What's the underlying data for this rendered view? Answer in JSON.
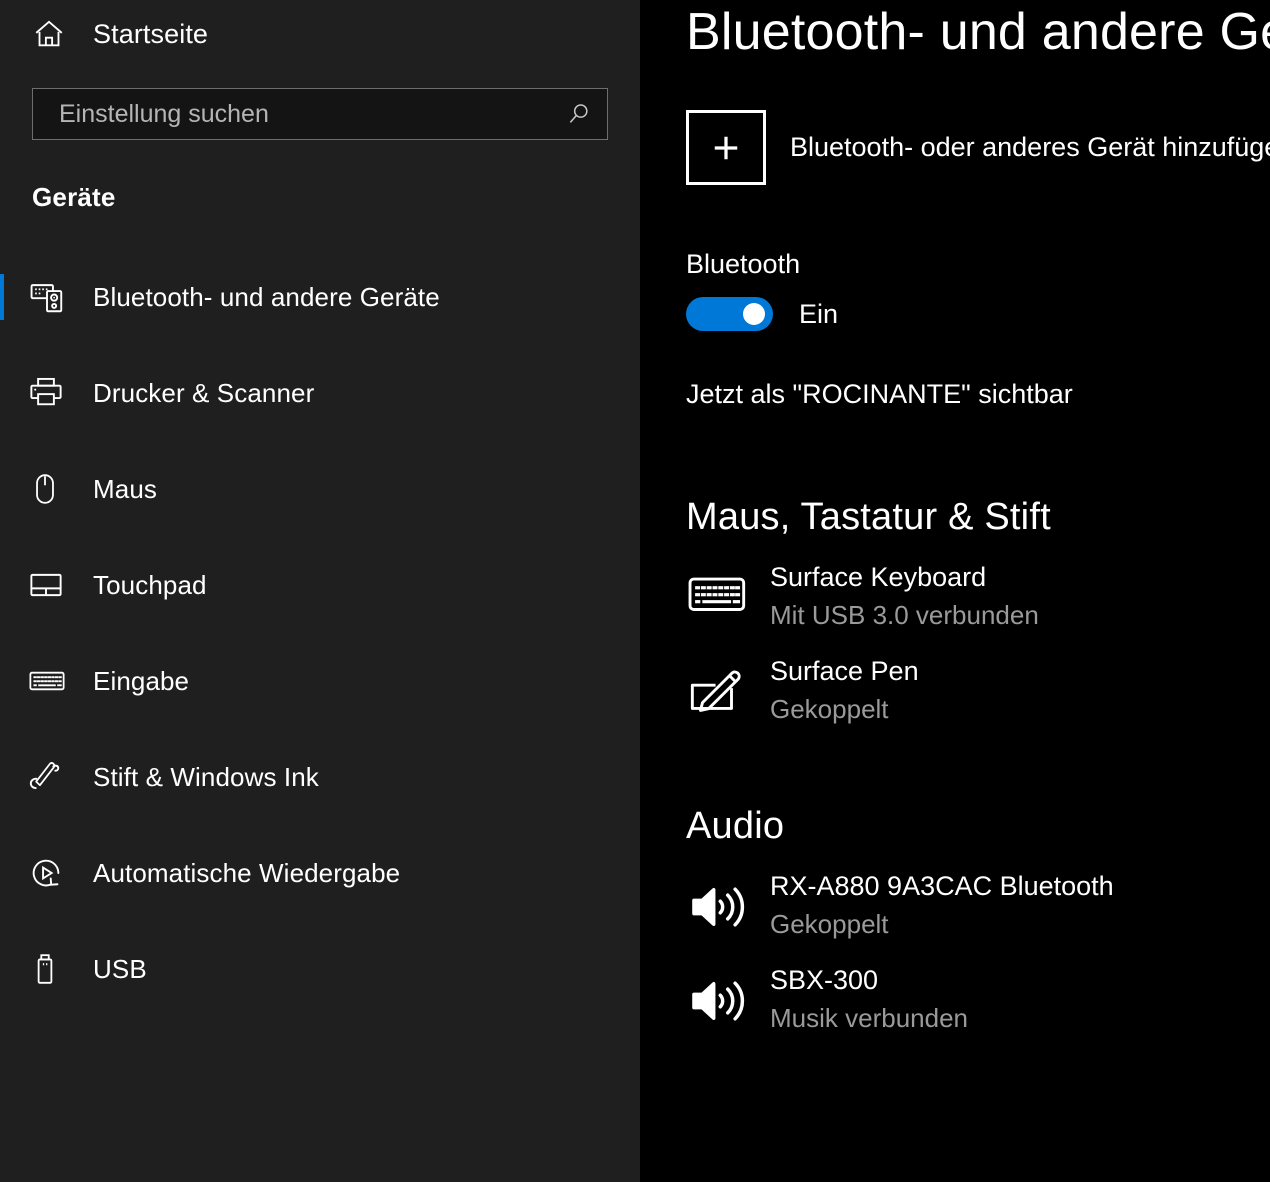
{
  "sidebar": {
    "home": {
      "label": "Startseite",
      "icon": "home-icon"
    },
    "search": {
      "placeholder": "Einstellung suchen",
      "value": "",
      "icon": "search-icon"
    },
    "group_title": "Geräte",
    "items": [
      {
        "label": "Bluetooth- und andere Geräte",
        "icon": "bluetooth-devices-icon",
        "selected": true
      },
      {
        "label": "Drucker & Scanner",
        "icon": "printer-icon",
        "selected": false
      },
      {
        "label": "Maus",
        "icon": "mouse-icon",
        "selected": false
      },
      {
        "label": "Touchpad",
        "icon": "touchpad-icon",
        "selected": false
      },
      {
        "label": "Eingabe",
        "icon": "keyboard-icon",
        "selected": false
      },
      {
        "label": "Stift & Windows Ink",
        "icon": "pen-icon",
        "selected": false
      },
      {
        "label": "Automatische Wiedergabe",
        "icon": "autoplay-icon",
        "selected": false
      },
      {
        "label": "USB",
        "icon": "usb-icon",
        "selected": false
      }
    ]
  },
  "main": {
    "title": "Bluetooth- und andere Geräte",
    "add_device": {
      "label": "Bluetooth- oder anderes Gerät hinzufügen",
      "icon": "plus-icon"
    },
    "bluetooth": {
      "label": "Bluetooth",
      "toggle_state": "Ein",
      "toggle_on": true,
      "visibility_note": "Jetzt als \"ROCINANTE\" sichtbar"
    },
    "sections": [
      {
        "heading": "Maus, Tastatur & Stift",
        "devices": [
          {
            "name": "Surface Keyboard",
            "status": "Mit USB 3.0 verbunden",
            "icon": "keyboard-icon"
          },
          {
            "name": "Surface Pen",
            "status": "Gekoppelt",
            "icon": "pen-tablet-icon"
          }
        ]
      },
      {
        "heading": "Audio",
        "devices": [
          {
            "name": "RX-A880 9A3CAC Bluetooth",
            "status": "Gekoppelt",
            "icon": "speaker-icon"
          },
          {
            "name": "SBX-300",
            "status": "Musik verbunden",
            "icon": "speaker-icon"
          }
        ]
      }
    ]
  },
  "colors": {
    "accent": "#0078D7",
    "sidebar_bg": "#1F1F1F",
    "main_bg": "#000000",
    "text_primary": "#FFFFFF",
    "text_secondary": "#9A9A9A"
  }
}
